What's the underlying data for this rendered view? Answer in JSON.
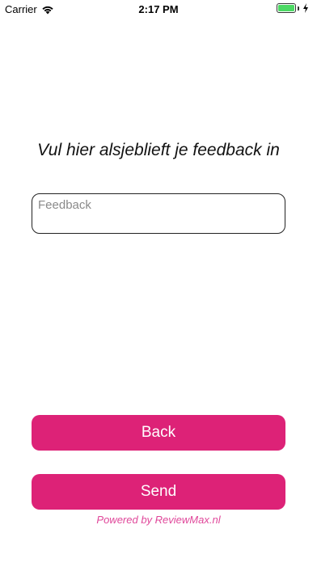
{
  "status_bar": {
    "carrier": "Carrier",
    "time": "2:17 PM",
    "battery_level": 1.0,
    "battery_color": "#4cd964",
    "icons": [
      "wifi-icon",
      "battery-icon",
      "charging-icon"
    ]
  },
  "prompt": "Vul hier alsjeblieft je feedback in",
  "feedback": {
    "placeholder": "Feedback",
    "value": ""
  },
  "buttons": {
    "back_label": "Back",
    "send_label": "Send",
    "color": "#dd2277"
  },
  "footer": {
    "powered_by": "Powered by ReviewMax.nl"
  }
}
